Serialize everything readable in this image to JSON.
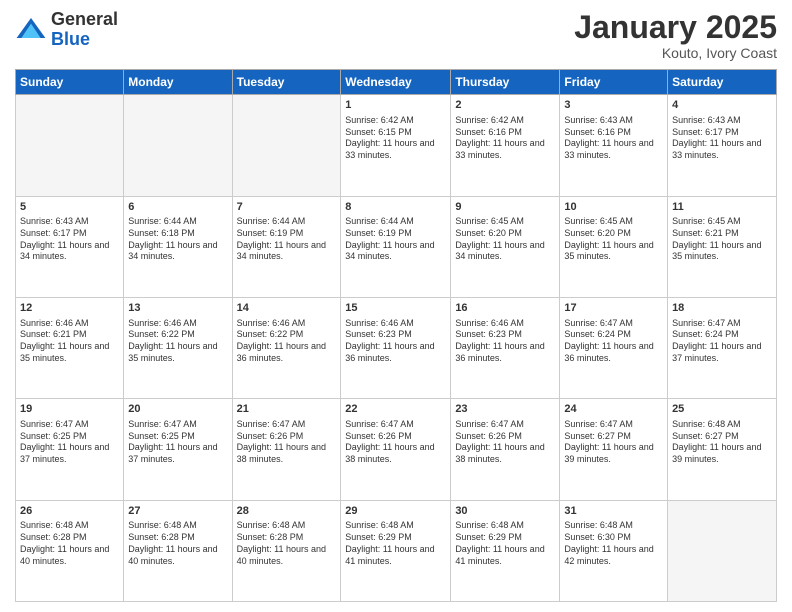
{
  "logo": {
    "general": "General",
    "blue": "Blue"
  },
  "header": {
    "month": "January 2025",
    "location": "Kouto, Ivory Coast"
  },
  "weekdays": [
    "Sunday",
    "Monday",
    "Tuesday",
    "Wednesday",
    "Thursday",
    "Friday",
    "Saturday"
  ],
  "weeks": [
    [
      {
        "day": "",
        "info": ""
      },
      {
        "day": "",
        "info": ""
      },
      {
        "day": "",
        "info": ""
      },
      {
        "day": "1",
        "info": "Sunrise: 6:42 AM\nSunset: 6:15 PM\nDaylight: 11 hours and 33 minutes."
      },
      {
        "day": "2",
        "info": "Sunrise: 6:42 AM\nSunset: 6:16 PM\nDaylight: 11 hours and 33 minutes."
      },
      {
        "day": "3",
        "info": "Sunrise: 6:43 AM\nSunset: 6:16 PM\nDaylight: 11 hours and 33 minutes."
      },
      {
        "day": "4",
        "info": "Sunrise: 6:43 AM\nSunset: 6:17 PM\nDaylight: 11 hours and 33 minutes."
      }
    ],
    [
      {
        "day": "5",
        "info": "Sunrise: 6:43 AM\nSunset: 6:17 PM\nDaylight: 11 hours and 34 minutes."
      },
      {
        "day": "6",
        "info": "Sunrise: 6:44 AM\nSunset: 6:18 PM\nDaylight: 11 hours and 34 minutes."
      },
      {
        "day": "7",
        "info": "Sunrise: 6:44 AM\nSunset: 6:19 PM\nDaylight: 11 hours and 34 minutes."
      },
      {
        "day": "8",
        "info": "Sunrise: 6:44 AM\nSunset: 6:19 PM\nDaylight: 11 hours and 34 minutes."
      },
      {
        "day": "9",
        "info": "Sunrise: 6:45 AM\nSunset: 6:20 PM\nDaylight: 11 hours and 34 minutes."
      },
      {
        "day": "10",
        "info": "Sunrise: 6:45 AM\nSunset: 6:20 PM\nDaylight: 11 hours and 35 minutes."
      },
      {
        "day": "11",
        "info": "Sunrise: 6:45 AM\nSunset: 6:21 PM\nDaylight: 11 hours and 35 minutes."
      }
    ],
    [
      {
        "day": "12",
        "info": "Sunrise: 6:46 AM\nSunset: 6:21 PM\nDaylight: 11 hours and 35 minutes."
      },
      {
        "day": "13",
        "info": "Sunrise: 6:46 AM\nSunset: 6:22 PM\nDaylight: 11 hours and 35 minutes."
      },
      {
        "day": "14",
        "info": "Sunrise: 6:46 AM\nSunset: 6:22 PM\nDaylight: 11 hours and 36 minutes."
      },
      {
        "day": "15",
        "info": "Sunrise: 6:46 AM\nSunset: 6:23 PM\nDaylight: 11 hours and 36 minutes."
      },
      {
        "day": "16",
        "info": "Sunrise: 6:46 AM\nSunset: 6:23 PM\nDaylight: 11 hours and 36 minutes."
      },
      {
        "day": "17",
        "info": "Sunrise: 6:47 AM\nSunset: 6:24 PM\nDaylight: 11 hours and 36 minutes."
      },
      {
        "day": "18",
        "info": "Sunrise: 6:47 AM\nSunset: 6:24 PM\nDaylight: 11 hours and 37 minutes."
      }
    ],
    [
      {
        "day": "19",
        "info": "Sunrise: 6:47 AM\nSunset: 6:25 PM\nDaylight: 11 hours and 37 minutes."
      },
      {
        "day": "20",
        "info": "Sunrise: 6:47 AM\nSunset: 6:25 PM\nDaylight: 11 hours and 37 minutes."
      },
      {
        "day": "21",
        "info": "Sunrise: 6:47 AM\nSunset: 6:26 PM\nDaylight: 11 hours and 38 minutes."
      },
      {
        "day": "22",
        "info": "Sunrise: 6:47 AM\nSunset: 6:26 PM\nDaylight: 11 hours and 38 minutes."
      },
      {
        "day": "23",
        "info": "Sunrise: 6:47 AM\nSunset: 6:26 PM\nDaylight: 11 hours and 38 minutes."
      },
      {
        "day": "24",
        "info": "Sunrise: 6:47 AM\nSunset: 6:27 PM\nDaylight: 11 hours and 39 minutes."
      },
      {
        "day": "25",
        "info": "Sunrise: 6:48 AM\nSunset: 6:27 PM\nDaylight: 11 hours and 39 minutes."
      }
    ],
    [
      {
        "day": "26",
        "info": "Sunrise: 6:48 AM\nSunset: 6:28 PM\nDaylight: 11 hours and 40 minutes."
      },
      {
        "day": "27",
        "info": "Sunrise: 6:48 AM\nSunset: 6:28 PM\nDaylight: 11 hours and 40 minutes."
      },
      {
        "day": "28",
        "info": "Sunrise: 6:48 AM\nSunset: 6:28 PM\nDaylight: 11 hours and 40 minutes."
      },
      {
        "day": "29",
        "info": "Sunrise: 6:48 AM\nSunset: 6:29 PM\nDaylight: 11 hours and 41 minutes."
      },
      {
        "day": "30",
        "info": "Sunrise: 6:48 AM\nSunset: 6:29 PM\nDaylight: 11 hours and 41 minutes."
      },
      {
        "day": "31",
        "info": "Sunrise: 6:48 AM\nSunset: 6:30 PM\nDaylight: 11 hours and 42 minutes."
      },
      {
        "day": "",
        "info": ""
      }
    ]
  ]
}
